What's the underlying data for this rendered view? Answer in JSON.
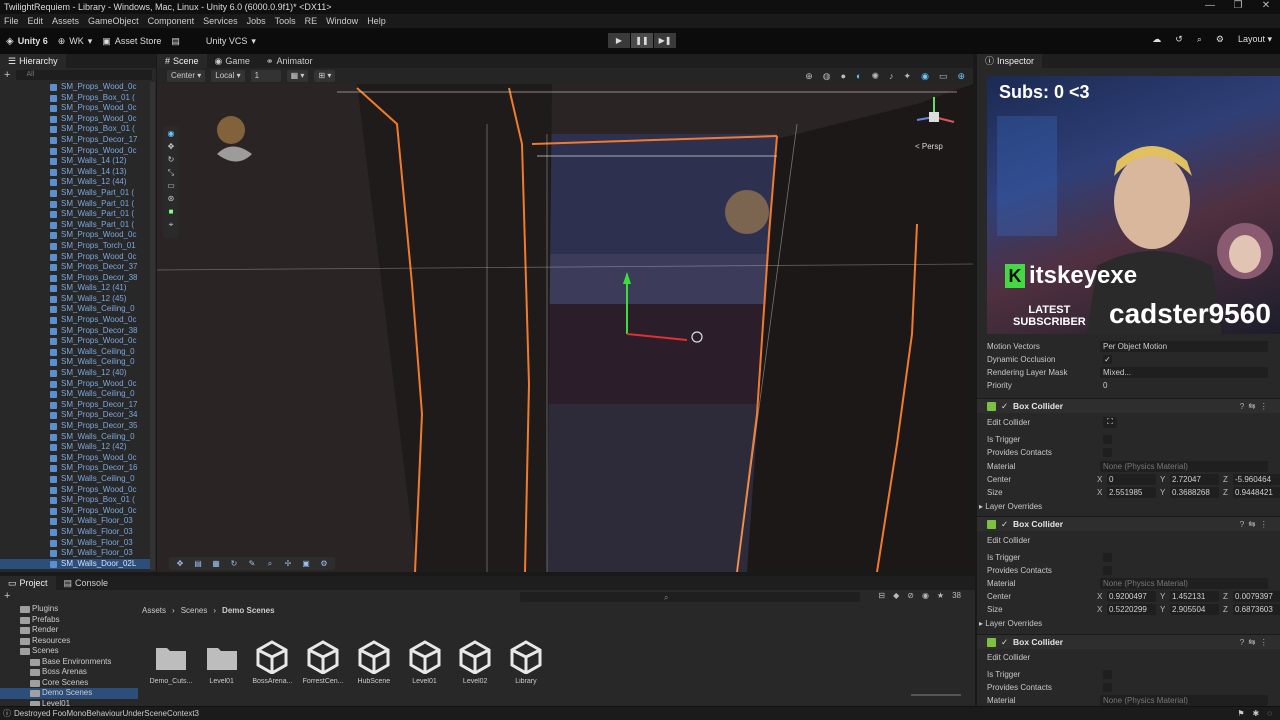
{
  "titlebar": {
    "title": "TwilightRequiem - Library - Windows, Mac, Linux - Unity 6.0 (6000.0.9f1)* <DX11>",
    "minimize": "—",
    "restore": "❐",
    "close": "✕"
  },
  "menu": [
    "File",
    "Edit",
    "Assets",
    "GameObject",
    "Component",
    "Services",
    "Jobs",
    "Tools",
    "RE",
    "Window",
    "Help"
  ],
  "toolbar": {
    "logo": "Unity 6",
    "account": "WK",
    "asset_store": "Asset Store",
    "vcs": "Unity VCS",
    "layout": "Layout"
  },
  "hierarchy": {
    "tab": "Hierarchy",
    "search_placeholder": "All",
    "items": [
      "SM_Props_Wood_0c",
      "SM_Props_Box_01 (",
      "SM_Props_Wood_0c",
      "SM_Props_Wood_0c",
      "SM_Props_Box_01 (",
      "SM_Props_Decor_17",
      "SM_Props_Wood_0c",
      "SM_Walls_14 (12)",
      "SM_Walls_14 (13)",
      "SM_Walls_12 (44)",
      "SM_Walls_Part_01 (",
      "SM_Walls_Part_01 (",
      "SM_Walls_Part_01 (",
      "SM_Walls_Part_01 (",
      "SM_Props_Wood_0c",
      "SM_Props_Torch_01",
      "SM_Props_Wood_0c",
      "SM_Props_Decor_37",
      "SM_Props_Decor_38",
      "SM_Walls_12 (41)",
      "SM_Walls_12 (45)",
      "SM_Walls_Ceiling_0",
      "SM_Props_Wood_0c",
      "SM_Props_Decor_38",
      "SM_Props_Wood_0c",
      "SM_Walls_Ceiling_0",
      "SM_Walls_Ceiling_0",
      "SM_Walls_12 (40)",
      "SM_Props_Wood_0c",
      "SM_Walls_Ceiling_0",
      "SM_Props_Decor_17",
      "SM_Props_Decor_34",
      "SM_Props_Decor_35",
      "SM_Walls_Ceiling_0",
      "SM_Walls_12 (42)",
      "SM_Props_Wood_0c",
      "SM_Props_Decor_16",
      "SM_Walls_Ceiling_0",
      "SM_Props_Wood_0c",
      "SM_Props_Box_01 (",
      "SM_Props_Wood_0c",
      "SM_Walls_Floor_03",
      "SM_Walls_Floor_03",
      "SM_Walls_Floor_03",
      "SM_Walls_Floor_03",
      "SM_Walls_Door_02L"
    ]
  },
  "scene": {
    "tabs": [
      "Scene",
      "Game",
      "Animator"
    ],
    "pivot": "Center",
    "space": "Local",
    "grid_snap": "1",
    "persp": "< Persp"
  },
  "inspector": {
    "tab": "Inspector",
    "mesh_rows": [
      {
        "label": "Motion Vectors",
        "value": "Per Object Motion"
      },
      {
        "label": "Dynamic Occlusion",
        "value": "✓"
      },
      {
        "label": "Rendering Layer Mask",
        "value": "Mixed..."
      },
      {
        "label": "Priority",
        "value": "0"
      }
    ],
    "colliders": [
      {
        "title": "Box Collider",
        "edit": "Edit Collider",
        "is_trigger": "Is Trigger",
        "provides": "Provides Contacts",
        "material_label": "Material",
        "material": "None (Physics Material)",
        "center_label": "Center",
        "center": [
          "0",
          "2.72047",
          "-5.960464"
        ],
        "size_label": "Size",
        "size": [
          "2.551985",
          "0.3688268",
          "0.9448421"
        ],
        "overrides": "Layer Overrides"
      },
      {
        "title": "Box Collider",
        "edit": "Edit Collider",
        "is_trigger": "Is Trigger",
        "provides": "Provides Contacts",
        "material_label": "Material",
        "material": "None (Physics Material)",
        "center_label": "Center",
        "center": [
          "0.9200497",
          "1.452131",
          "0.0079397"
        ],
        "size_label": "Size",
        "size": [
          "0.5220299",
          "2.905504",
          "0.6873603"
        ],
        "overrides": "Layer Overrides"
      },
      {
        "title": "Box Collider",
        "edit": "Edit Collider",
        "is_trigger": "Is Trigger",
        "provides": "Provides Contacts",
        "material_label": "Material",
        "material": "None (Physics Material)"
      }
    ]
  },
  "overlay": {
    "subs": "Subs: 0 <3",
    "brand": "itskeyexe",
    "latest": "LATEST",
    "subscriber": "SUBSCRIBER",
    "name": "cadster9560"
  },
  "project": {
    "tabs": [
      "Project",
      "Console"
    ],
    "tree": [
      "Plugins",
      "Prefabs",
      "Render",
      "Resources",
      "Scenes",
      "Base Environments",
      "Boss Arenas",
      "Core Scenes",
      "Demo Scenes",
      "Level01"
    ],
    "breadcrumb": [
      "Assets",
      "Scenes",
      "Demo Scenes"
    ],
    "count": "38",
    "assets": [
      {
        "name": "Demo_Cuts...",
        "kind": "folder"
      },
      {
        "name": "Level01",
        "kind": "folder"
      },
      {
        "name": "BossArena...",
        "kind": "unity"
      },
      {
        "name": "ForrestCen...",
        "kind": "unity"
      },
      {
        "name": "HubScene",
        "kind": "unity"
      },
      {
        "name": "Level01",
        "kind": "unity"
      },
      {
        "name": "Level02",
        "kind": "unity"
      },
      {
        "name": "Library",
        "kind": "unity"
      }
    ]
  },
  "status": {
    "message": "Destroyed FooMonoBehaviourUnderSceneContext3"
  }
}
